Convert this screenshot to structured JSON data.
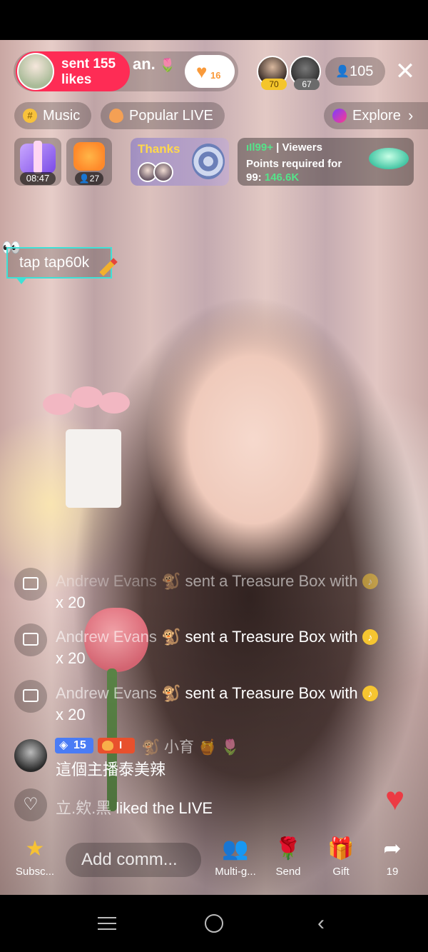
{
  "host": {
    "sent_line1": "sent 155",
    "sent_line2": "likes",
    "name": "an.",
    "name_emoji": "🌷",
    "like_count": "16"
  },
  "top_viewers": [
    {
      "badge": "70"
    },
    {
      "badge": "67"
    }
  ],
  "viewer_count": "105",
  "chips": {
    "music": "Music",
    "popular": "Popular LIVE",
    "explore": "Explore"
  },
  "widgets": {
    "chest_timer": "08:47",
    "group_count": "27",
    "thanks_label": "Thanks",
    "viewers_top": "99+",
    "viewers_label": "Viewers",
    "points_line1": "Points required for",
    "points_line2_prefix": "99:",
    "points_value": "146.6K"
  },
  "tap_bubble": "tap tap60k",
  "comments": [
    {
      "name": "Andrew Evans",
      "text": "sent a Treasure Box with",
      "qty": "x 20"
    },
    {
      "name": "Andrew Evans",
      "text": "sent a Treasure Box with",
      "qty": "x 20"
    },
    {
      "name": "Andrew Evans",
      "text": "sent a Treasure Box with",
      "qty": "x 20"
    }
  ],
  "chat_user": {
    "level": "15",
    "fan_level": "I",
    "name": "小育",
    "message": "這個主播泰美辣"
  },
  "liked": {
    "name": "立.欸.黑",
    "text": "liked the LIVE"
  },
  "bottom_bar": {
    "subscribe": "Subsc...",
    "comment_placeholder": "Add comm...",
    "multi_guest": "Multi-g...",
    "send": "Send",
    "gift": "Gift",
    "share_count": "19"
  }
}
